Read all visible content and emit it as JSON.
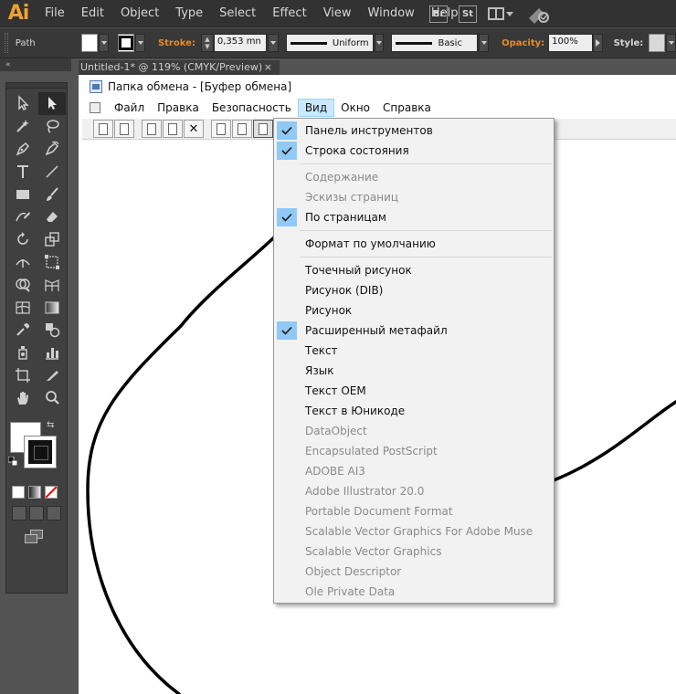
{
  "app": {
    "logo": "Ai",
    "menu": [
      "File",
      "Edit",
      "Object",
      "Type",
      "Select",
      "Effect",
      "View",
      "Window",
      "Help"
    ],
    "icons": [
      "Br",
      "St"
    ]
  },
  "control_bar": {
    "object_type": "Path",
    "stroke_label": "Stroke:",
    "stroke_weight": "0,353 mn",
    "stroke_profile": "Uniform",
    "brush": "Basic",
    "opacity_label": "Opacity:",
    "opacity_value": "100%",
    "style_label": "Style:"
  },
  "document_tab": {
    "title": "Untitled-1* @ 119% (CMYK/Preview)",
    "close": "×"
  },
  "clipboard_window": {
    "title": "Папка обмена - [Буфер обмена]",
    "menu": [
      "Файл",
      "Правка",
      "Безопасность",
      "Вид",
      "Окно",
      "Справка"
    ],
    "open_menu": "Вид"
  },
  "view_menu": {
    "groups": [
      [
        {
          "label": "Панель инструментов",
          "checked": true,
          "enabled": true
        },
        {
          "label": "Строка состояния",
          "checked": true,
          "enabled": true
        }
      ],
      [
        {
          "label": "Содержание",
          "checked": false,
          "enabled": false
        },
        {
          "label": "Эскизы страниц",
          "checked": false,
          "enabled": false
        },
        {
          "label": "По страницам",
          "checked": true,
          "enabled": true
        }
      ],
      [
        {
          "label": "Формат по умолчанию",
          "checked": false,
          "enabled": true
        }
      ],
      [
        {
          "label": "Точечный рисунок",
          "checked": false,
          "enabled": true
        },
        {
          "label": "Рисунок (DIB)",
          "checked": false,
          "enabled": true
        },
        {
          "label": "Рисунок",
          "checked": false,
          "enabled": true
        },
        {
          "label": "Расширенный метафайл",
          "checked": true,
          "enabled": true
        },
        {
          "label": "Текст",
          "checked": false,
          "enabled": true
        },
        {
          "label": "Язык",
          "checked": false,
          "enabled": true
        },
        {
          "label": "Текст OEM",
          "checked": false,
          "enabled": true
        },
        {
          "label": "Текст в Юникоде",
          "checked": false,
          "enabled": true
        },
        {
          "label": "DataObject",
          "checked": false,
          "enabled": false
        },
        {
          "label": "Encapsulated PostScript",
          "checked": false,
          "enabled": false
        },
        {
          "label": "ADOBE AI3",
          "checked": false,
          "enabled": false
        },
        {
          "label": "Adobe Illustrator 20.0",
          "checked": false,
          "enabled": false
        },
        {
          "label": "Portable Document Format",
          "checked": false,
          "enabled": false
        },
        {
          "label": "Scalable Vector Graphics For Adobe Muse",
          "checked": false,
          "enabled": false
        },
        {
          "label": "Scalable Vector Graphics",
          "checked": false,
          "enabled": false
        },
        {
          "label": "Object Descriptor",
          "checked": false,
          "enabled": false
        },
        {
          "label": "Ole Private Data",
          "checked": false,
          "enabled": false
        }
      ]
    ]
  },
  "colors": {
    "ai_chrome": "#323232",
    "ai_orange": "#e38b2d",
    "check_highlight": "#90c8f6",
    "open_menu_highlight": "#cce8ff"
  }
}
